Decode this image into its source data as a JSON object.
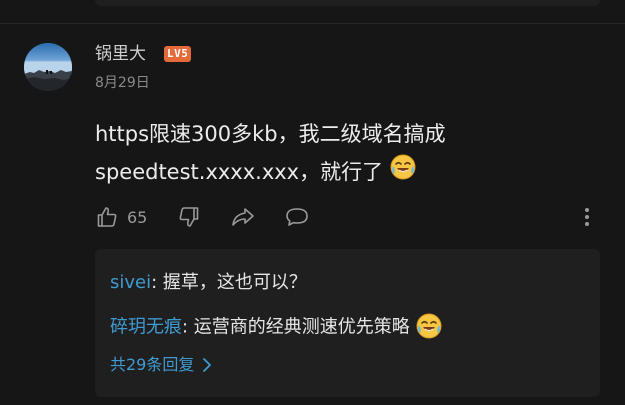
{
  "comment": {
    "username": "锅里大",
    "level": "LV5",
    "date": "8月29日",
    "content_line1": "https限速300多kb，我二级域名搞成",
    "content_line2": "speedtest.xxxx.xxx，就行了",
    "content_emoji": "laughing-tears-emoji",
    "like_count": "65"
  },
  "actions": {
    "icons": [
      "thumbs-up-icon",
      "thumbs-down-icon",
      "share-icon",
      "comment-icon",
      "more-vertical-icon"
    ]
  },
  "replies": {
    "items": [
      {
        "name": "sivei",
        "separator": ": ",
        "text": "握草，这也可以？"
      },
      {
        "name": "碎玥无痕",
        "separator": ": ",
        "text": "运营商的经典测速优先策略",
        "emoji": "laughing-tears-emoji"
      }
    ],
    "more_label": "共29条回复"
  },
  "colors": {
    "background": "#161616",
    "reply_panel": "#1f1f1f",
    "link_blue": "#3f9bd1",
    "level_badge": "#e46a3a",
    "muted_text": "#8a8a8a"
  }
}
